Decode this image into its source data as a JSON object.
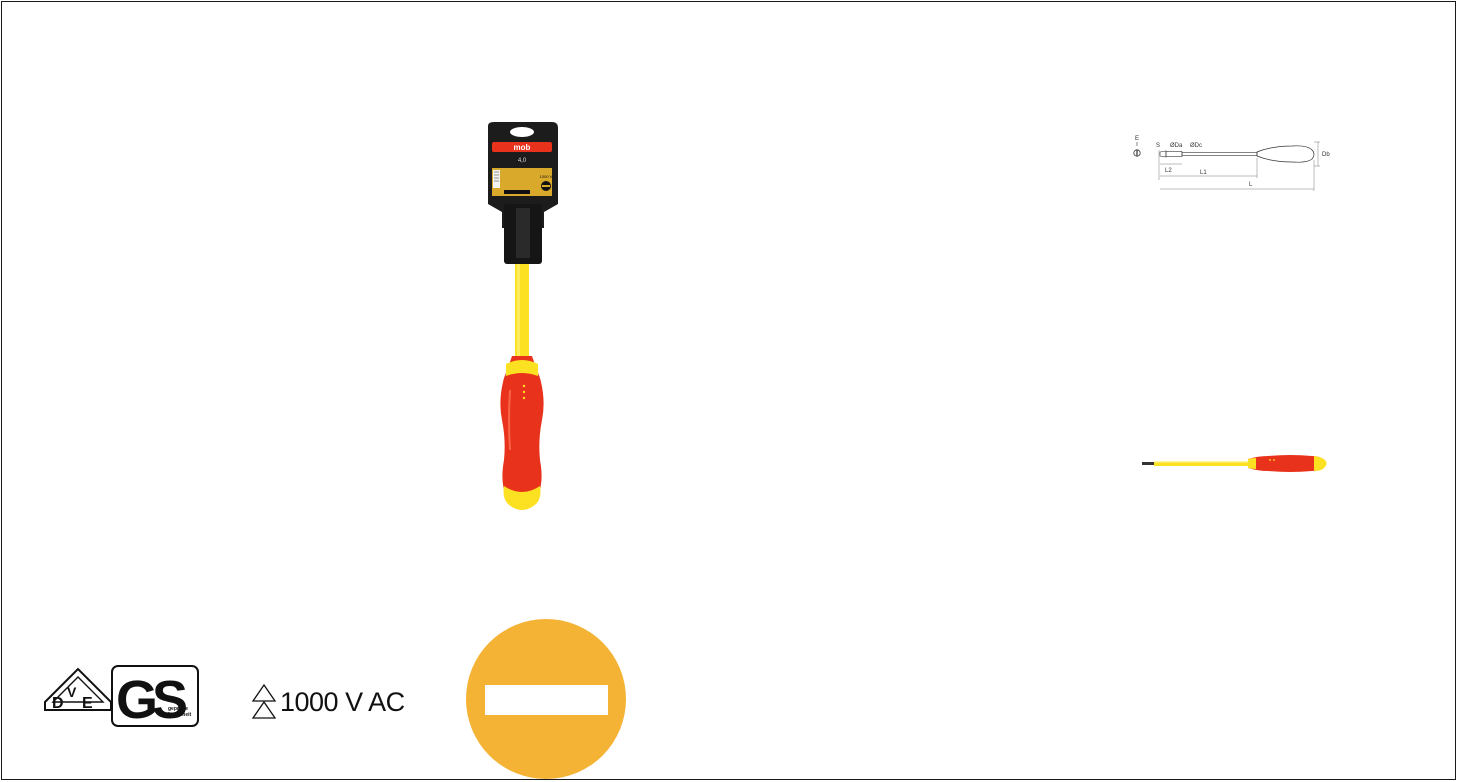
{
  "colors": {
    "handle_red": "#e8321b",
    "insulation_yellow": "#fbe122",
    "badge_orange": "#f5b335",
    "card_black": "#1c1c1c",
    "card_gold": "#d9a92c"
  },
  "packaging": {
    "brand": "mob",
    "size": "4,0",
    "voltage": "1000 V"
  },
  "diagram": {
    "label_E": "E",
    "label_S": "S",
    "label_Da": "ØDa",
    "label_Dc": "ØDc",
    "label_Db": "Db",
    "label_L2": "L2",
    "label_L1": "L1",
    "label_L": "L"
  },
  "certification": {
    "dve": {
      "d": "D",
      "v": "V",
      "e": "E"
    },
    "gs_text": "GS",
    "gs_caption_1": "geprüfte",
    "gs_caption_2": "Sicherheit",
    "voltage_rating": "1000 V AC"
  },
  "icons": {
    "dve": "dve-mark-icon",
    "gs": "gs-mark-icon",
    "voltage": "double-triangle-icon",
    "slotted": "slotted-tip-icon"
  }
}
